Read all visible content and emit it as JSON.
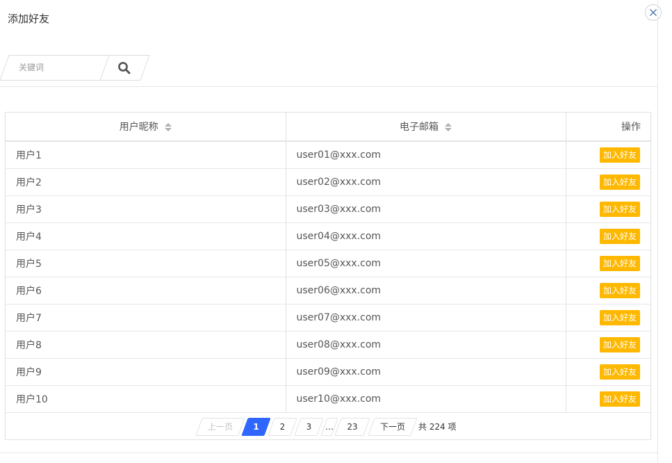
{
  "dialog": {
    "title": "添加好友"
  },
  "search": {
    "placeholder": "关键词"
  },
  "table": {
    "columns": {
      "nickname": "用户昵称",
      "email": "电子邮箱",
      "action": "操作"
    },
    "add_label": "加入好友",
    "rows": [
      {
        "nickname": "用户1",
        "email": "user01@xxx.com"
      },
      {
        "nickname": "用户2",
        "email": "user02@xxx.com"
      },
      {
        "nickname": "用户3",
        "email": "user03@xxx.com"
      },
      {
        "nickname": "用户4",
        "email": "user04@xxx.com"
      },
      {
        "nickname": "用户5",
        "email": "user05@xxx.com"
      },
      {
        "nickname": "用户6",
        "email": "user06@xxx.com"
      },
      {
        "nickname": "用户7",
        "email": "user07@xxx.com"
      },
      {
        "nickname": "用户8",
        "email": "user08@xxx.com"
      },
      {
        "nickname": "用户9",
        "email": "user09@xxx.com"
      },
      {
        "nickname": "用户10",
        "email": "user10@xxx.com"
      }
    ]
  },
  "pagination": {
    "prev": "上一页",
    "pages": [
      "1",
      "2",
      "3"
    ],
    "ellipsis": "…",
    "last_page": "23",
    "next": "下一页",
    "total": "共 224 项"
  },
  "colors": {
    "accent": "#2f66ff",
    "add_button": "#ffb800"
  }
}
